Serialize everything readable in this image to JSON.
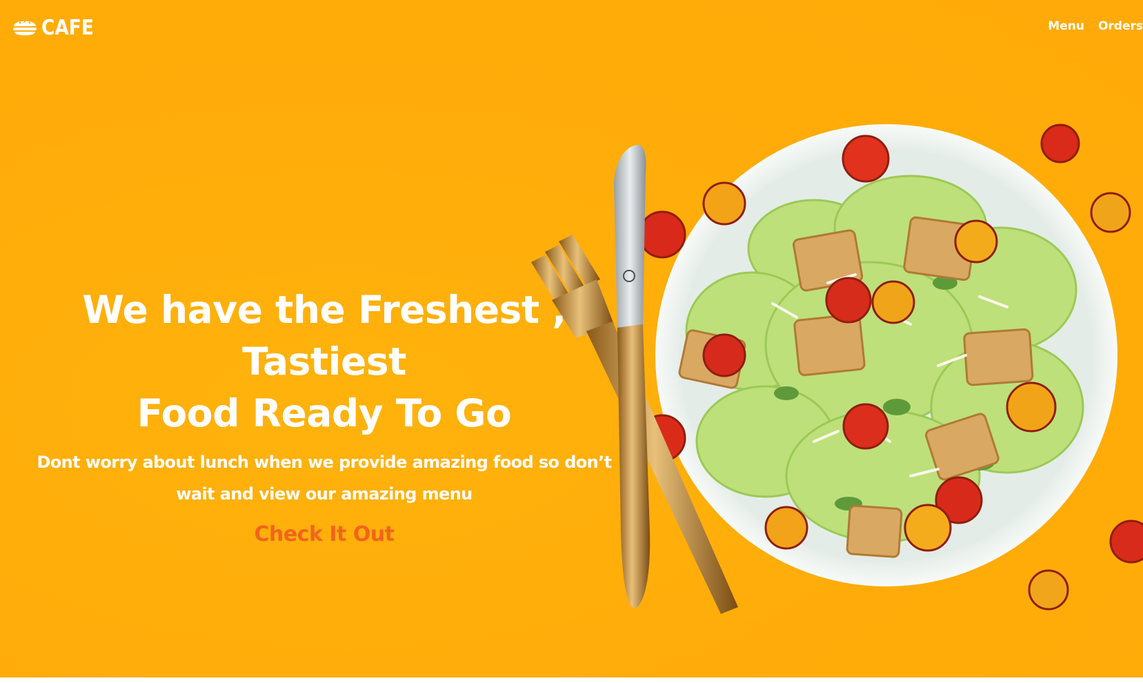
{
  "brand": {
    "name": "CAFE",
    "icon": "burger-icon"
  },
  "nav": {
    "items": [
      {
        "label": "Menu"
      },
      {
        "label": "Orders"
      }
    ]
  },
  "hero": {
    "headline_line1": "We have the Freshest , Tastiest",
    "headline_line2": "Food Ready To Go",
    "subtext_line1": "Dont worry about lunch when we provide amazing food so don’t",
    "subtext_line2": "wait and view our amazing menu",
    "cta_label": "Check It Out"
  },
  "image": {
    "subject": "salad-plate-with-fork-and-knife"
  },
  "colors": {
    "background": "#ffad0a",
    "text": "#ffffff",
    "cta": "#f2641d"
  }
}
